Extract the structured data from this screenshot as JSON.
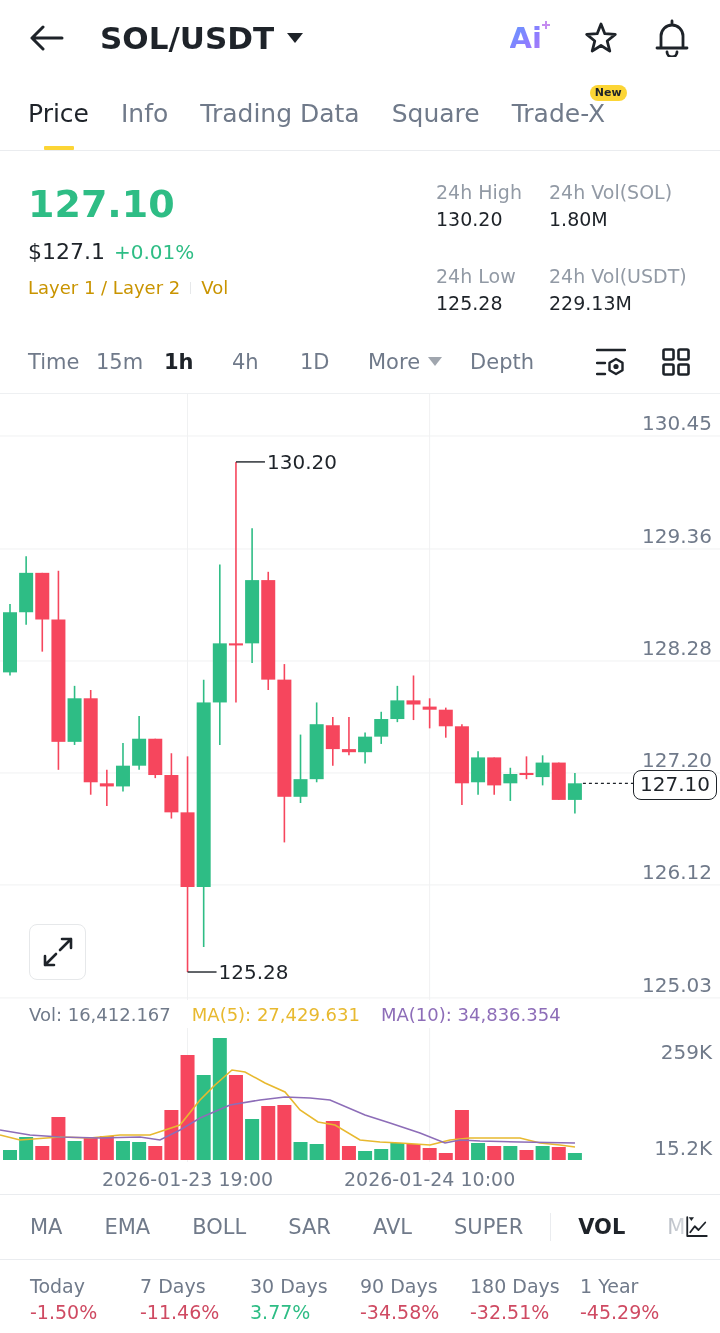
{
  "header": {
    "pair": "SOL/USDT",
    "ai_label": "Ai"
  },
  "tabs": [
    {
      "label": "Price",
      "selected": true
    },
    {
      "label": "Info",
      "selected": false
    },
    {
      "label": "Trading Data",
      "selected": false
    },
    {
      "label": "Square",
      "selected": false
    },
    {
      "label": "Trade-X",
      "selected": false,
      "badge": "New"
    }
  ],
  "ticker": {
    "last_price": "127.10",
    "fiat_price": "$127.1",
    "change": "+0.01%",
    "tags": [
      "Layer 1 / Layer 2",
      "Vol"
    ]
  },
  "stats": [
    {
      "label": "24h High",
      "value": "130.20"
    },
    {
      "label": "24h Vol(SOL)",
      "value": "1.80M"
    },
    {
      "label": "24h Low",
      "value": "125.28"
    },
    {
      "label": "24h Vol(USDT)",
      "value": "229.13M"
    }
  ],
  "intervals": [
    {
      "label": "Time",
      "kind": "option",
      "selected": false
    },
    {
      "label": "15m",
      "kind": "option",
      "selected": false
    },
    {
      "label": "1h",
      "kind": "option",
      "selected": true
    },
    {
      "label": "4h",
      "kind": "option",
      "selected": false
    },
    {
      "label": "1D",
      "kind": "option",
      "selected": false
    },
    {
      "label": "More",
      "kind": "dropdown",
      "selected": false
    },
    {
      "label": "Depth",
      "kind": "option",
      "selected": false
    }
  ],
  "chart": {
    "chart_data": {
      "type": "candlestick",
      "categories": [
        null,
        null,
        null,
        null,
        null,
        null,
        null,
        null,
        null,
        null,
        null,
        null,
        null,
        null,
        null,
        null,
        null,
        null,
        null,
        null,
        null,
        null,
        null,
        null,
        null,
        null,
        null,
        null,
        null,
        null,
        null,
        null,
        null,
        null,
        null,
        null
      ],
      "ohlc": [
        [
          128.17,
          128.83,
          128.14,
          128.75
        ],
        [
          128.75,
          129.29,
          128.63,
          129.13
        ],
        [
          129.13,
          129.13,
          128.37,
          128.68
        ],
        [
          128.68,
          129.15,
          127.23,
          127.5
        ],
        [
          127.5,
          128.04,
          127.47,
          127.92
        ],
        [
          127.92,
          128.0,
          126.99,
          127.11
        ],
        [
          127.1,
          127.23,
          126.88,
          127.07
        ],
        [
          127.07,
          127.49,
          127.02,
          127.27
        ],
        [
          127.27,
          127.75,
          127.23,
          127.53
        ],
        [
          127.53,
          127.53,
          127.15,
          127.18
        ],
        [
          127.18,
          127.39,
          126.76,
          126.82
        ],
        [
          126.82,
          127.36,
          125.28,
          126.1
        ],
        [
          126.1,
          128.1,
          125.52,
          127.88
        ],
        [
          127.88,
          129.21,
          127.47,
          128.45
        ],
        [
          128.45,
          130.2,
          127.88,
          128.43
        ],
        [
          128.45,
          129.56,
          128.26,
          129.06
        ],
        [
          129.06,
          129.14,
          128.0,
          128.1
        ],
        [
          128.1,
          128.25,
          126.53,
          126.97
        ],
        [
          126.97,
          127.57,
          126.91,
          127.14
        ],
        [
          127.14,
          127.88,
          127.11,
          127.67
        ],
        [
          127.66,
          127.74,
          127.27,
          127.43
        ],
        [
          127.43,
          127.74,
          127.37,
          127.4
        ],
        [
          127.4,
          127.59,
          127.29,
          127.55
        ],
        [
          127.55,
          127.79,
          127.48,
          127.72
        ],
        [
          127.72,
          128.04,
          127.69,
          127.9
        ],
        [
          127.9,
          128.14,
          127.71,
          127.86
        ],
        [
          127.84,
          127.92,
          127.63,
          127.81
        ],
        [
          127.81,
          127.83,
          127.54,
          127.65
        ],
        [
          127.65,
          127.67,
          126.89,
          127.1
        ],
        [
          127.11,
          127.41,
          126.99,
          127.35
        ],
        [
          127.35,
          127.35,
          126.99,
          127.08
        ],
        [
          127.1,
          127.25,
          126.93,
          127.19
        ],
        [
          127.2,
          127.36,
          127.14,
          127.18
        ],
        [
          127.16,
          127.37,
          127.08,
          127.3
        ],
        [
          127.3,
          127.3,
          126.94,
          126.94
        ],
        [
          126.94,
          127.2,
          126.81,
          127.1
        ]
      ],
      "ylim": [
        125.01,
        130.855
      ],
      "yticks": [
        {
          "value": 130.45,
          "label": "130.45"
        },
        {
          "value": 129.36,
          "label": "129.36"
        },
        {
          "value": 128.28,
          "label": "128.28"
        },
        {
          "value": 127.2,
          "label": "127.20"
        },
        {
          "value": 126.12,
          "label": "126.12"
        },
        {
          "value": 125.03,
          "label": "125.03"
        }
      ],
      "grid": true
    },
    "high_label": "130.20",
    "low_label": "125.28",
    "last_price_tag": "127.10"
  },
  "volume": {
    "vol": "Vol: 16,412.167",
    "ma5": "MA(5): 27,429.631",
    "ma10": "MA(10): 34,836.354",
    "axis": [
      "259K",
      "15.2K"
    ]
  },
  "time_axis": [
    "2026-01-23 19:00",
    "2026-01-24 10:00"
  ],
  "indicators": {
    "main": [
      {
        "label": "MA",
        "selected": false
      },
      {
        "label": "EMA",
        "selected": false
      },
      {
        "label": "BOLL",
        "selected": false
      },
      {
        "label": "SAR",
        "selected": false
      },
      {
        "label": "AVL",
        "selected": false
      },
      {
        "label": "SUPER",
        "selected": false
      }
    ],
    "sub": [
      {
        "label": "VOL",
        "selected": true
      },
      {
        "label": "M",
        "selected": false
      }
    ]
  },
  "performance": [
    {
      "period": "Today",
      "change": "-1.50%",
      "color": "#cf4a62"
    },
    {
      "period": "7 Days",
      "change": "-11.46%",
      "color": "#cf4a62"
    },
    {
      "period": "30 Days",
      "change": "3.77%",
      "color": "#2ebd85"
    },
    {
      "period": "90 Days",
      "change": "-34.58%",
      "color": "#cf4a62"
    },
    {
      "period": "180 Days",
      "change": "-32.51%",
      "color": "#cf4a62"
    },
    {
      "period": "1 Year",
      "change": "-45.29%",
      "color": "#cf4a62"
    }
  ]
}
